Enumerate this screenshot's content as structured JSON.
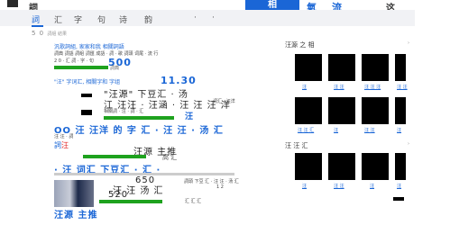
{
  "header": {
    "brand": "詞",
    "search_button": "相",
    "links": [
      "氣",
      "流"
    ],
    "right": "这"
  },
  "nav": {
    "tabs": [
      "詞",
      "汇",
      "字",
      "句",
      "诗",
      "韵",
      "·",
      "·"
    ]
  },
  "result_count": {
    "value": "5 0",
    "label": "詞組 結果"
  },
  "results": [
    {
      "title": "汎歌詞組, 家家和我 相關詞語",
      "snippet": "詞典 詞語 詞組 詞匯 成語 · 詞 · 歌 詞頭 词尾 · 流 行",
      "extra": "2 0 · 汇 詞 · 字 · 句",
      "big": "500",
      "source": "詞典"
    },
    {
      "title": "\"汪\" 字词汇, 相關字和 字组",
      "big_title": "11.30",
      "line1": "\"汪源\" 下豆汇 · 汤",
      "line2": "江 汪汪 · 汪涵 · 汪 汪 汪 洋",
      "meta": "相關詞 · 汪 · 詞 · 汇",
      "badge": "汪",
      "aside": "词汇 · 汪洋"
    },
    {
      "big_title": "OO 汪 汪洋 的 字 汇 · 汪 汪 · 汤 汇",
      "line1": "汪 汪 · 詞",
      "line2": "汪源 主推",
      "line3": "高 汇"
    },
    {
      "big_title": "· 汪 词汇 下豆汇 · 汇 ·",
      "snippet": "詞頭 下豆 汇 · 汪 汪 · 汤 汇",
      "number1": "650",
      "number2": "520",
      "line1": "汪 汪 汤 汇",
      "meta": "1 2",
      "footer_title": "汪源 主推",
      "source": "汇 汇 汇"
    }
  ],
  "sidebar": {
    "section1_title": "汪源 之 相",
    "row1_captions": [
      "汪",
      "汪 汪",
      "汪 汪 汪",
      "汪 汪"
    ],
    "row2_captions": [
      "汪 汪 汇",
      "汪",
      "汪 汪",
      "汪"
    ],
    "section2_title": "汪 汪 汇",
    "row3_captions": [
      "汪",
      "汪 汪",
      "汪",
      "汪"
    ]
  }
}
